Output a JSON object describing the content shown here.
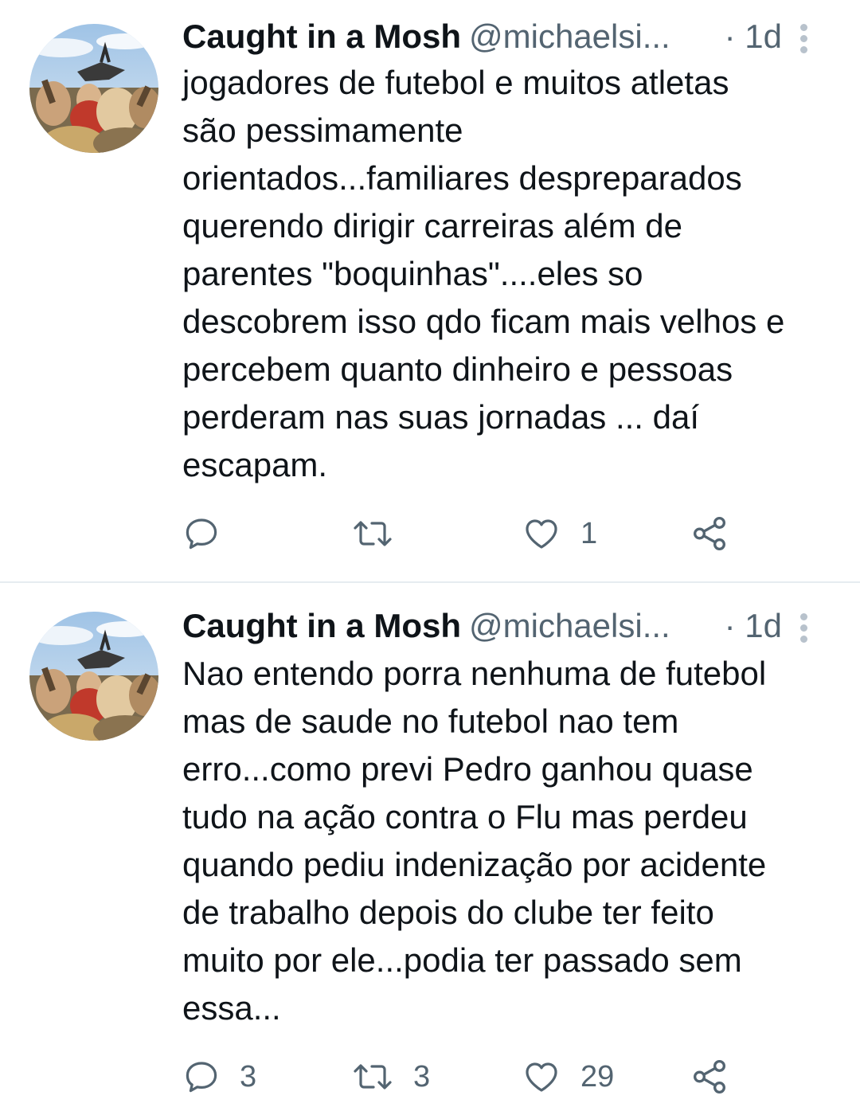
{
  "tweets": [
    {
      "author_name": "Caught in a Mosh",
      "handle": "@michaelsi...",
      "time": "· 1d",
      "body_lines": [
        "jogadores de futebol e muitos atletas",
        "são pessimamente",
        "orientados...familiares despreparados",
        "querendo dirigir carreiras além de",
        "parentes \"boquinhas\"....eles so",
        "descobrem isso qdo ficam mais velhos e",
        "percebem quanto dinheiro e pessoas",
        "perderam nas suas jornadas ... daí",
        "escapam."
      ],
      "replies": "",
      "retweets": "",
      "likes": "1"
    },
    {
      "author_name": "Caught in a Mosh",
      "handle": "@michaelsi...",
      "time": "· 1d",
      "body_lines": [
        "Nao entendo porra nenhuma de futebol",
        "mas de saude no futebol nao tem",
        "erro...como previ Pedro ganhou quase",
        "tudo na ação contra o Flu mas perdeu",
        "quando pediu indenização por acidente",
        "de trabalho depois do clube ter feito",
        "muito por ele...podia ter passado sem",
        "essa..."
      ],
      "replies": "3",
      "retweets": "3",
      "likes": "29"
    }
  ],
  "icons": {
    "reply": "reply-icon",
    "retweet": "retweet-icon",
    "like": "heart-icon",
    "share": "share-icon",
    "more": "more-vertical-icon"
  },
  "colors": {
    "text_primary": "#0f1419",
    "text_secondary": "#536471",
    "divider": "#e6ecf0"
  }
}
